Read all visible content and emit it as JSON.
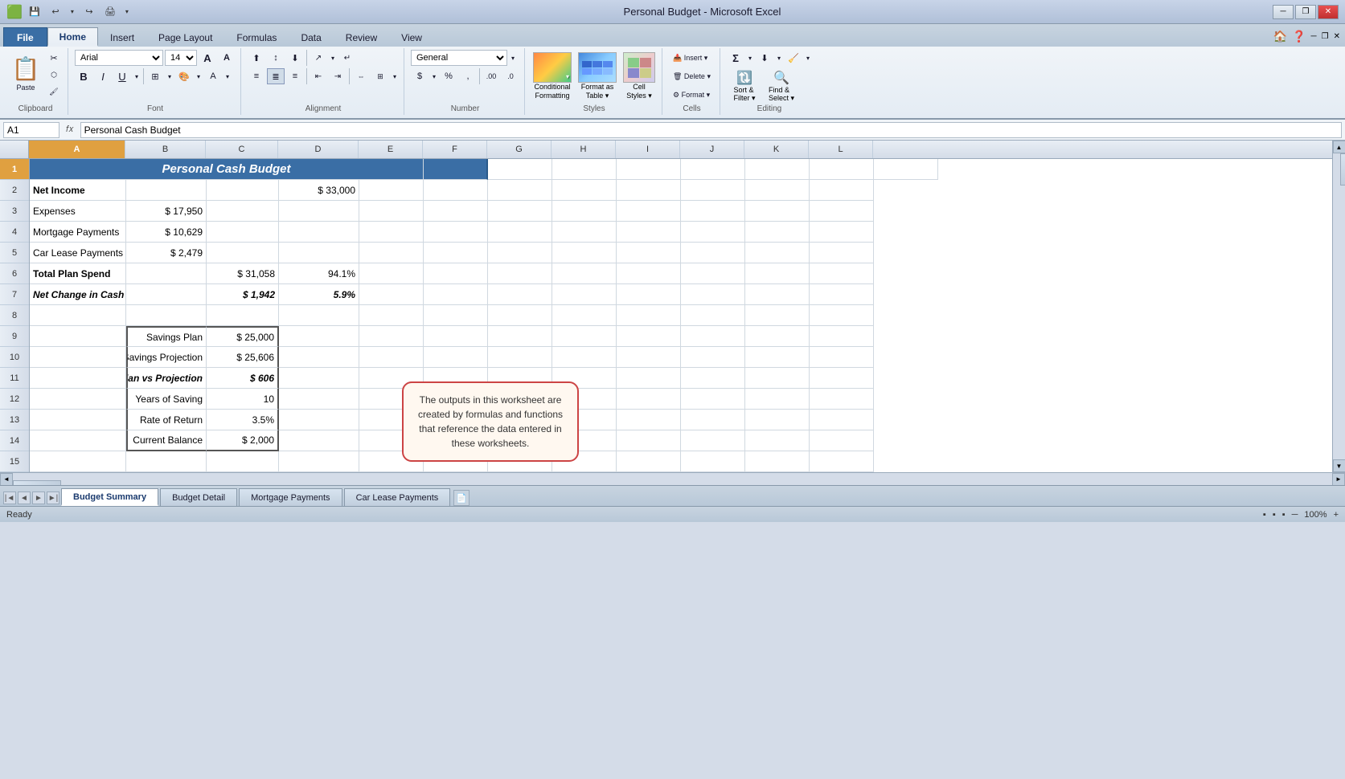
{
  "window": {
    "title": "Personal Budget - Microsoft Excel",
    "minimize": "─",
    "restore": "❐",
    "close": "✕"
  },
  "quickaccess": {
    "save": "💾",
    "undo": "↩",
    "undo_arrow": "▾",
    "redo": "↪",
    "print": "🖨",
    "dropdown": "▾"
  },
  "tabs": [
    "File",
    "Home",
    "Insert",
    "Page Layout",
    "Formulas",
    "Data",
    "Review",
    "View"
  ],
  "active_tab": "Home",
  "ribbon": {
    "clipboard_label": "Clipboard",
    "font_label": "Font",
    "alignment_label": "Alignment",
    "number_label": "Number",
    "styles_label": "Styles",
    "cells_label": "Cells",
    "editing_label": "Editing",
    "font_name": "Arial",
    "font_size": "14",
    "bold": "B",
    "italic": "I",
    "underline": "U",
    "paste": "Paste",
    "cut": "✂",
    "copy": "⬡",
    "format_painter": "🖌",
    "align_left": "≡",
    "align_center": "≣",
    "align_right": "≡",
    "number_format": "General",
    "conditional_formatting": "Conditional\nFormatting",
    "format_as_table": "Format as\nTable",
    "cell_styles": "Cell\nStyles",
    "insert": "Insert",
    "delete": "Delete",
    "format": "Format",
    "sum": "Σ",
    "sort_filter": "Sort &\nFilter",
    "find_select": "Find &\nSelect"
  },
  "formula_bar": {
    "cell_ref": "A1",
    "formula": "Personal Cash Budget"
  },
  "columns": [
    "A",
    "B",
    "C",
    "D",
    "E",
    "F",
    "G",
    "H",
    "I",
    "J",
    "K",
    "L"
  ],
  "rows": [
    1,
    2,
    3,
    4,
    5,
    6,
    7,
    8,
    9,
    10,
    11,
    12,
    13,
    14,
    15
  ],
  "cells": {
    "r1": {
      "a": "Personal Cash Budget",
      "merged": true,
      "style": "header-blue"
    },
    "r2": {
      "a": "Net Income",
      "style": "bold",
      "d": "$   33,000"
    },
    "r3": {
      "a": "Expenses",
      "b": "$   17,950"
    },
    "r4": {
      "a": "Mortgage Payments",
      "b": "$   10,629"
    },
    "r5": {
      "a": "Car Lease Payments",
      "b": "$     2,479"
    },
    "r6": {
      "a": "Total Plan Spend",
      "style": "bold",
      "c": "$   31,058",
      "d": "94.1%"
    },
    "r7": {
      "a": "Net Change in Cash",
      "style": "italic-bold",
      "c": "$     1,942",
      "d": "5.9%"
    },
    "r9": {
      "b": "Savings Plan",
      "c": "$   25,000",
      "inner": true
    },
    "r10": {
      "b": "Savings Projection",
      "c": "$   25,606",
      "inner": true
    },
    "r11": {
      "b": "Plan vs Projection",
      "c": "$         606",
      "inner": true,
      "bold": true
    },
    "r12": {
      "b": "Years of Saving",
      "c": "10",
      "inner": true
    },
    "r13": {
      "b": "Rate of Return",
      "c": "3.5%",
      "inner": true
    },
    "r14": {
      "b": "Current Balance",
      "c": "$     2,000",
      "inner": true
    }
  },
  "tooltip": {
    "text": "The outputs in this worksheet are created by formulas and functions that reference the data entered in these worksheets."
  },
  "sheet_tabs": [
    "Budget Summary",
    "Budget Detail",
    "Mortgage Payments",
    "Car Lease Payments"
  ],
  "active_sheet": "Budget Summary",
  "status": {
    "left": "Ready",
    "right": "▪ ▪ ▪    100%    —  ⊕ +"
  }
}
